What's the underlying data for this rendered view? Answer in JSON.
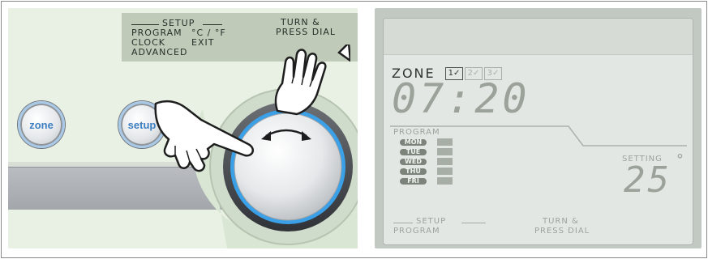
{
  "device": {
    "menu": {
      "setup": "Setup",
      "turn_press_line1": "Turn &",
      "turn_press_line2": "Press Dial",
      "program": "Program",
      "celsius_fahrenheit": "°C / °F",
      "clock": "Clock",
      "exit": "Exit",
      "advanced": "Advanced"
    },
    "buttons": {
      "zone": "zone",
      "setup": "setup"
    }
  },
  "lcd": {
    "zone_label": "Zone",
    "zones": [
      {
        "number": "1",
        "check": "✓",
        "active": true
      },
      {
        "number": "2",
        "check": "✓",
        "active": false
      },
      {
        "number": "3",
        "check": "✓",
        "active": false
      }
    ],
    "time": "07:20",
    "program_label": "Program",
    "days": [
      "MON",
      "TUE",
      "WED",
      "THU",
      "FRI"
    ],
    "setting_label": "Setting",
    "setting_value": "25",
    "degree": "°",
    "bottom_setup": "Setup",
    "bottom_program": "Program",
    "bottom_turn_line1": "Turn &",
    "bottom_turn_line2": "Press Dial"
  },
  "colors": {
    "device_background": "#e9f1e5",
    "menu_box": "#bfcab8",
    "dial_ring": "#3aa0e8",
    "lcd_background": "#e3e7e3",
    "button_text": "#3d7fc2"
  },
  "icons": {
    "dial_arrow": "double-headed-curved-arrow-icon",
    "hand_top": "pointing-hand-icon",
    "hand_side": "pointing-hand-icon"
  }
}
